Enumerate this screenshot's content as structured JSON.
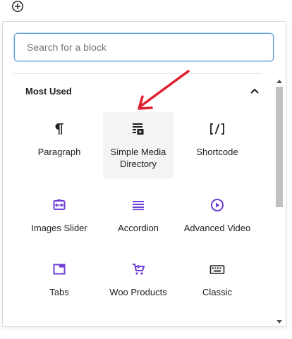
{
  "inserter": {
    "toggle_icon": "plus-circle-icon",
    "search": {
      "placeholder": "Search for a block",
      "value": ""
    },
    "section": {
      "title": "Most Used",
      "expanded": true
    },
    "blocks": [
      {
        "id": "paragraph",
        "label": "Paragraph",
        "icon": "paragraph-icon",
        "active": false
      },
      {
        "id": "simple-media-directory",
        "label": "Simple Media Directory",
        "icon": "media-directory-icon",
        "active": true
      },
      {
        "id": "shortcode",
        "label": "Shortcode",
        "icon": "shortcode-icon",
        "active": false
      },
      {
        "id": "images-slider",
        "label": "Images Slider",
        "icon": "images-slider-icon",
        "active": false
      },
      {
        "id": "accordion",
        "label": "Accordion",
        "icon": "accordion-icon",
        "active": false
      },
      {
        "id": "advanced-video",
        "label": "Advanced Video",
        "icon": "play-circle-icon",
        "active": false
      },
      {
        "id": "tabs",
        "label": "Tabs",
        "icon": "tabs-icon",
        "active": false
      },
      {
        "id": "woo-products",
        "label": "Woo Products",
        "icon": "cart-icon",
        "active": false
      },
      {
        "id": "classic",
        "label": "Classic",
        "icon": "keyboard-icon",
        "active": false
      }
    ]
  },
  "colors": {
    "accent_purple": "#6d3fd6",
    "focus_blue": "#5b9dd9",
    "annotation_red": "#e0202e",
    "text": "#1e1e1e"
  }
}
